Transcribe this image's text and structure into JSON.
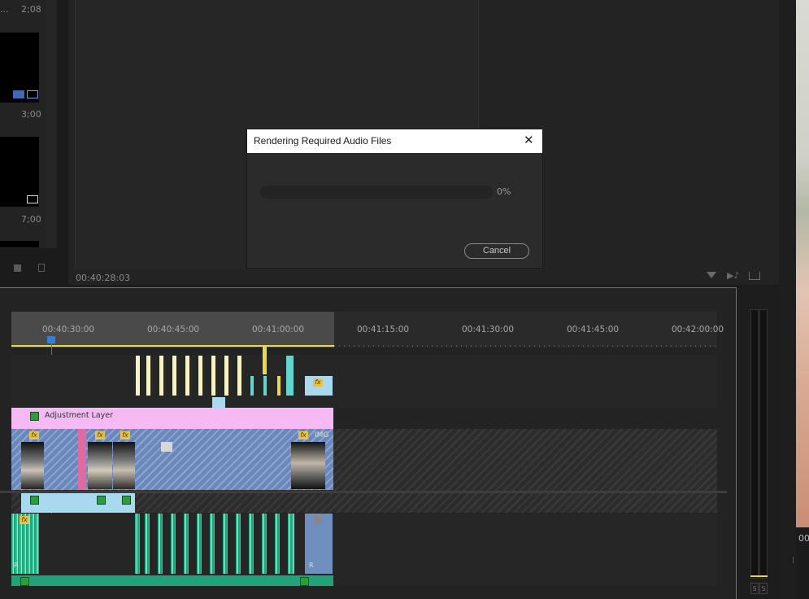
{
  "project_panel": {
    "items": [
      {
        "name": "...",
        "duration": "2;08"
      },
      {
        "name": "",
        "duration": "3;00"
      },
      {
        "name": "",
        "duration": "7;00"
      }
    ]
  },
  "program_monitor": {
    "timecode": "00:40:28:03"
  },
  "dialog": {
    "title": "Rendering Required Audio Files",
    "close_glyph": "✕",
    "progress_percent": 0,
    "progress_text": "0%",
    "cancel_label": "Cancel"
  },
  "timeline": {
    "ruler_ticks": [
      "00:40:30:00",
      "00:40:45:00",
      "00:41:00:00",
      "00:41:15:00",
      "00:41:30:00",
      "00:41:45:00",
      "00:42:00:00"
    ],
    "adjustment_layer_label": "Adjustment Layer",
    "img_label": "IMG",
    "fx_label": "fx",
    "r_label": "R"
  },
  "meter": {
    "solo_labels": [
      "S",
      "S"
    ]
  },
  "right_panel": {
    "timecode_fragment": "00"
  },
  "icons": {
    "filter": "filter-icon",
    "audio": "audio-icon",
    "export": "export-frame-icon",
    "trash": "trash-icon",
    "new_item": "new-item-icon"
  },
  "colors": {
    "accent_blue": "#2f7ee8",
    "work_area_yellow": "#e8d94a",
    "adjustment_layer": "#f5b9f4",
    "clip_blue": "#6f8fbf",
    "audio_green": "#23a27a",
    "clip_pink": "#e06aa2"
  }
}
